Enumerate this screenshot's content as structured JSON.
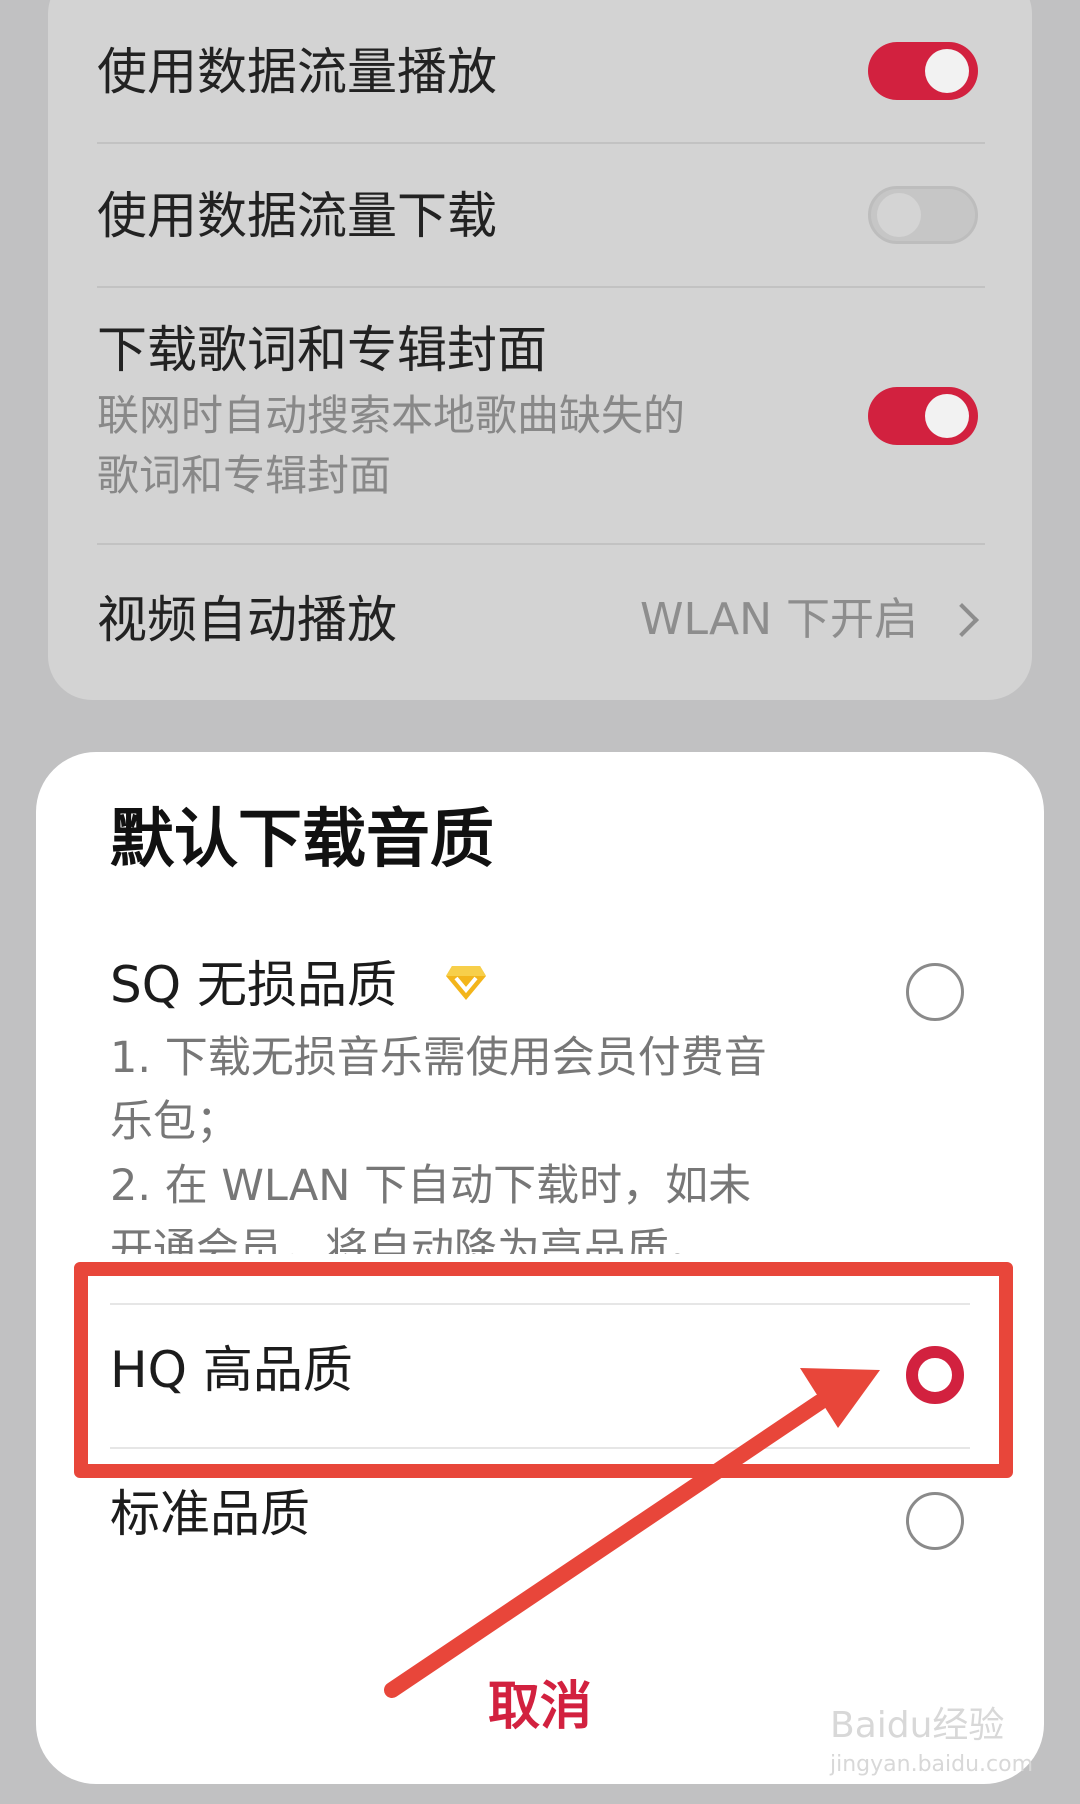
{
  "settings": {
    "rows": [
      {
        "title": "使用数据流量播放",
        "toggle": "on"
      },
      {
        "title": "使用数据流量下载",
        "toggle": "off"
      },
      {
        "title": "下载歌词和专辑封面",
        "desc_line1": "联网时自动搜索本地歌曲缺失的",
        "desc_line2": "歌词和专辑封面",
        "toggle": "on"
      },
      {
        "title": "视频自动播放",
        "value": "WLAN 下开启"
      }
    ]
  },
  "dialog": {
    "title": "默认下载音质",
    "options": [
      {
        "title": "SQ 无损品质",
        "icon": "diamond-vip-icon",
        "desc": [
          "1. 下载无损音乐需使用会员付费音",
          "乐包；",
          "2. 在 WLAN 下自动下载时，如未",
          "开通会员，将自动降为高品质。"
        ],
        "selected": false
      },
      {
        "title": "HQ 高品质",
        "selected": true
      },
      {
        "title": "标准品质",
        "selected": false
      }
    ],
    "cancel_label": "取消"
  },
  "watermark": {
    "text": "Baidu经验",
    "sub": "jingyan.baidu.com"
  },
  "colors": {
    "accent": "#d2213f",
    "annotation": "#e8463a"
  }
}
